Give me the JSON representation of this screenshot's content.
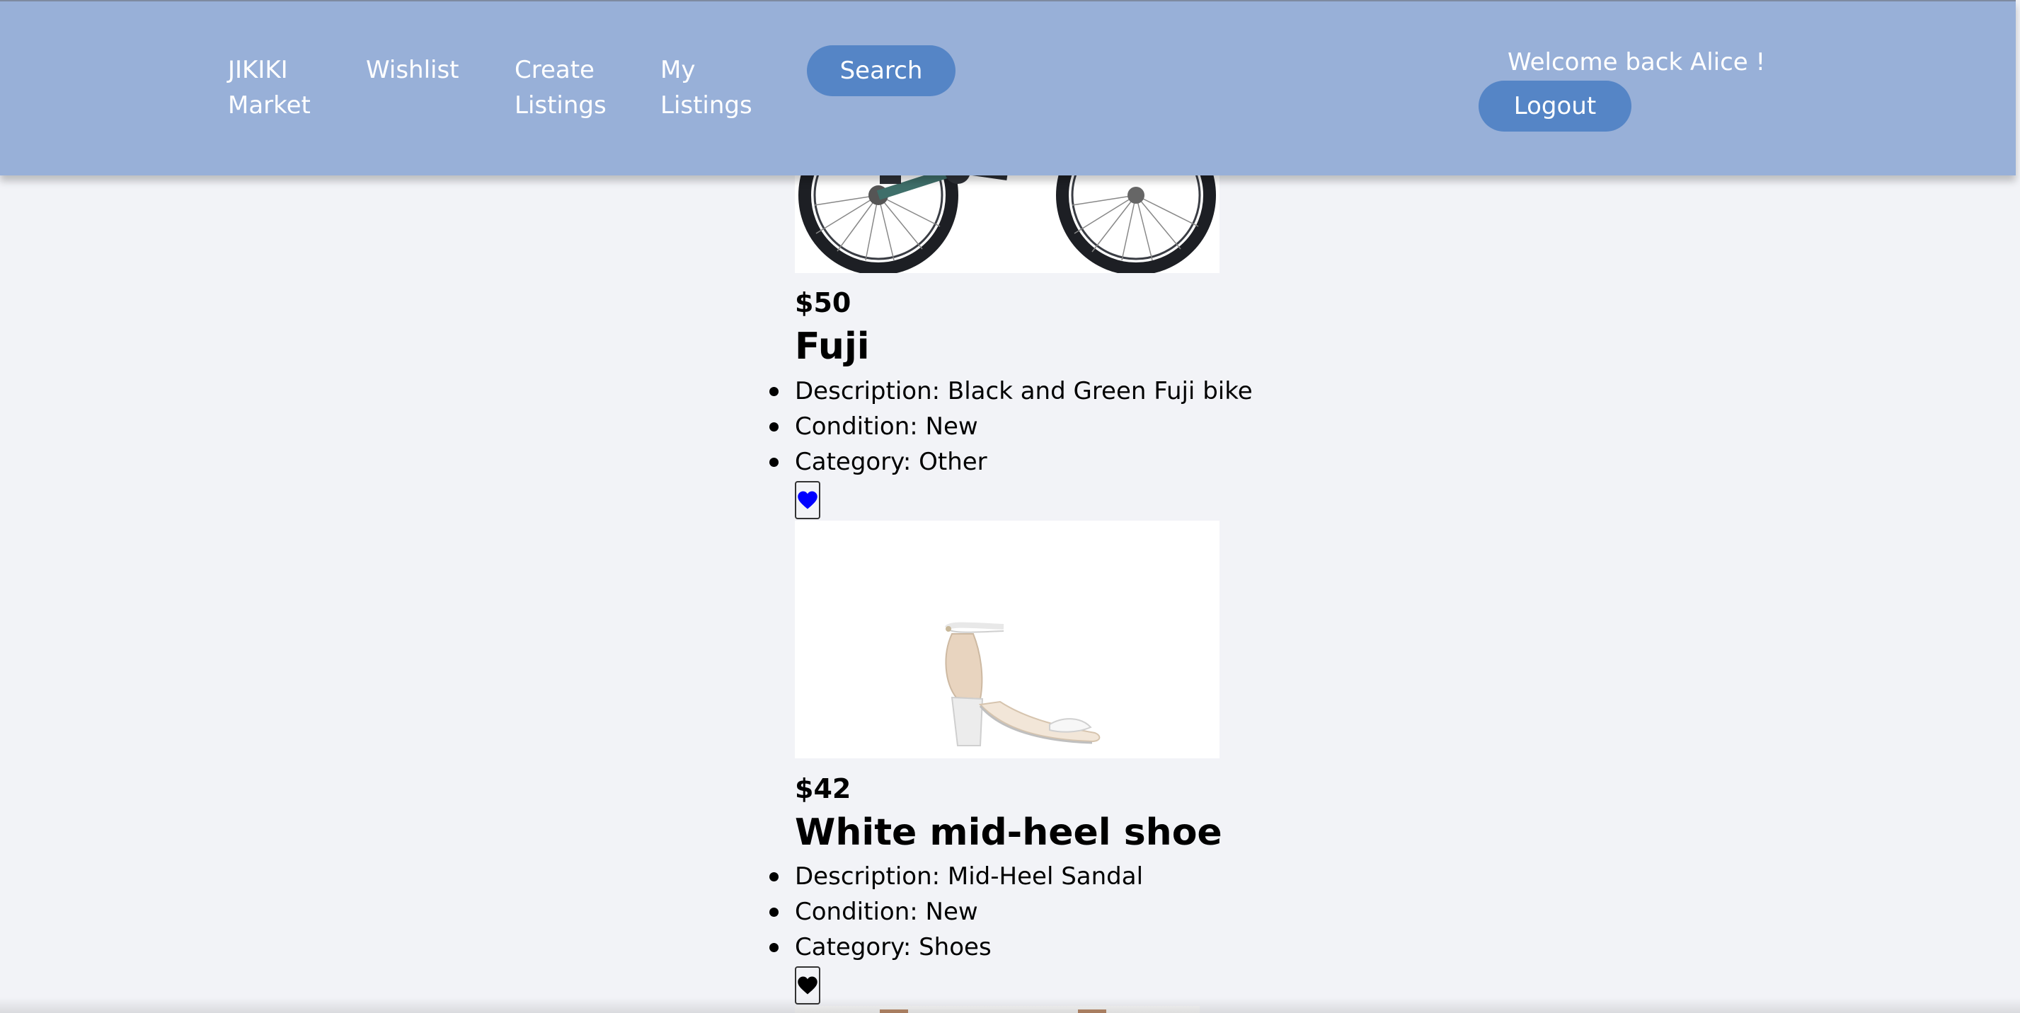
{
  "navbar": {
    "brand": "JIKIKI Market",
    "wishlist": "Wishlist",
    "create_listings": "Create Listings",
    "my_listings": "My Listings",
    "search": "Search",
    "welcome": "Welcome back Alice !",
    "logout": "Logout"
  },
  "listings": [
    {
      "price": "$50",
      "title": "Fuji",
      "description": "Description: Black and Green Fuji bike",
      "condition": "Condition: New",
      "category": "Category: Other",
      "wishlisted": true,
      "heart_color": "#0000ff",
      "image": "bike-image"
    },
    {
      "price": "$42",
      "title": "White mid-heel shoe",
      "description": "Description: Mid-Heel Sandal",
      "condition": "Condition: New",
      "category": "Category: Shoes",
      "wishlisted": false,
      "heart_color": "#000000",
      "image": "sandal-image"
    }
  ],
  "colors": {
    "navbar_bg": "#98b0d8",
    "button_bg": "#5585c6",
    "page_bg": "#f2f3f7"
  }
}
